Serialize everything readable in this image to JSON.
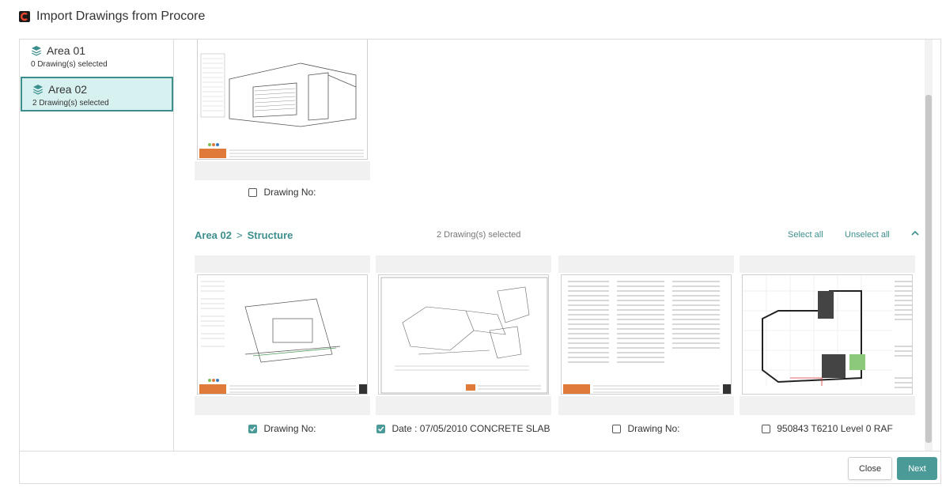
{
  "window": {
    "title": "Import Drawings from Procore"
  },
  "sidebar": {
    "areas": [
      {
        "name": "Area 01",
        "count_text": "0 Drawing(s) selected",
        "selected": false
      },
      {
        "name": "Area 02",
        "count_text": "2 Drawing(s) selected",
        "selected": true
      }
    ]
  },
  "section_above": {
    "drawings": [
      {
        "label": "Drawing No:",
        "checked": false
      }
    ]
  },
  "section": {
    "area": "Area 02",
    "separator": ">",
    "folder": "Structure",
    "selected_count": "2 Drawing(s) selected",
    "select_all": "Select all",
    "unselect_all": "Unselect all",
    "drawings": [
      {
        "label": "Drawing No:",
        "checked": true
      },
      {
        "label": "Date : 07/05/2010 CONCRETE SLAB",
        "checked": true
      },
      {
        "label": "Drawing No:",
        "checked": false
      },
      {
        "label": "950843 T6210 Level 0 RAF",
        "checked": false
      }
    ]
  },
  "footer": {
    "close_label": "Close",
    "next_label": "Next"
  },
  "colors": {
    "accent": "#4a9a98",
    "selected_bg": "#d7f1f0",
    "logo": "#e8442e"
  }
}
